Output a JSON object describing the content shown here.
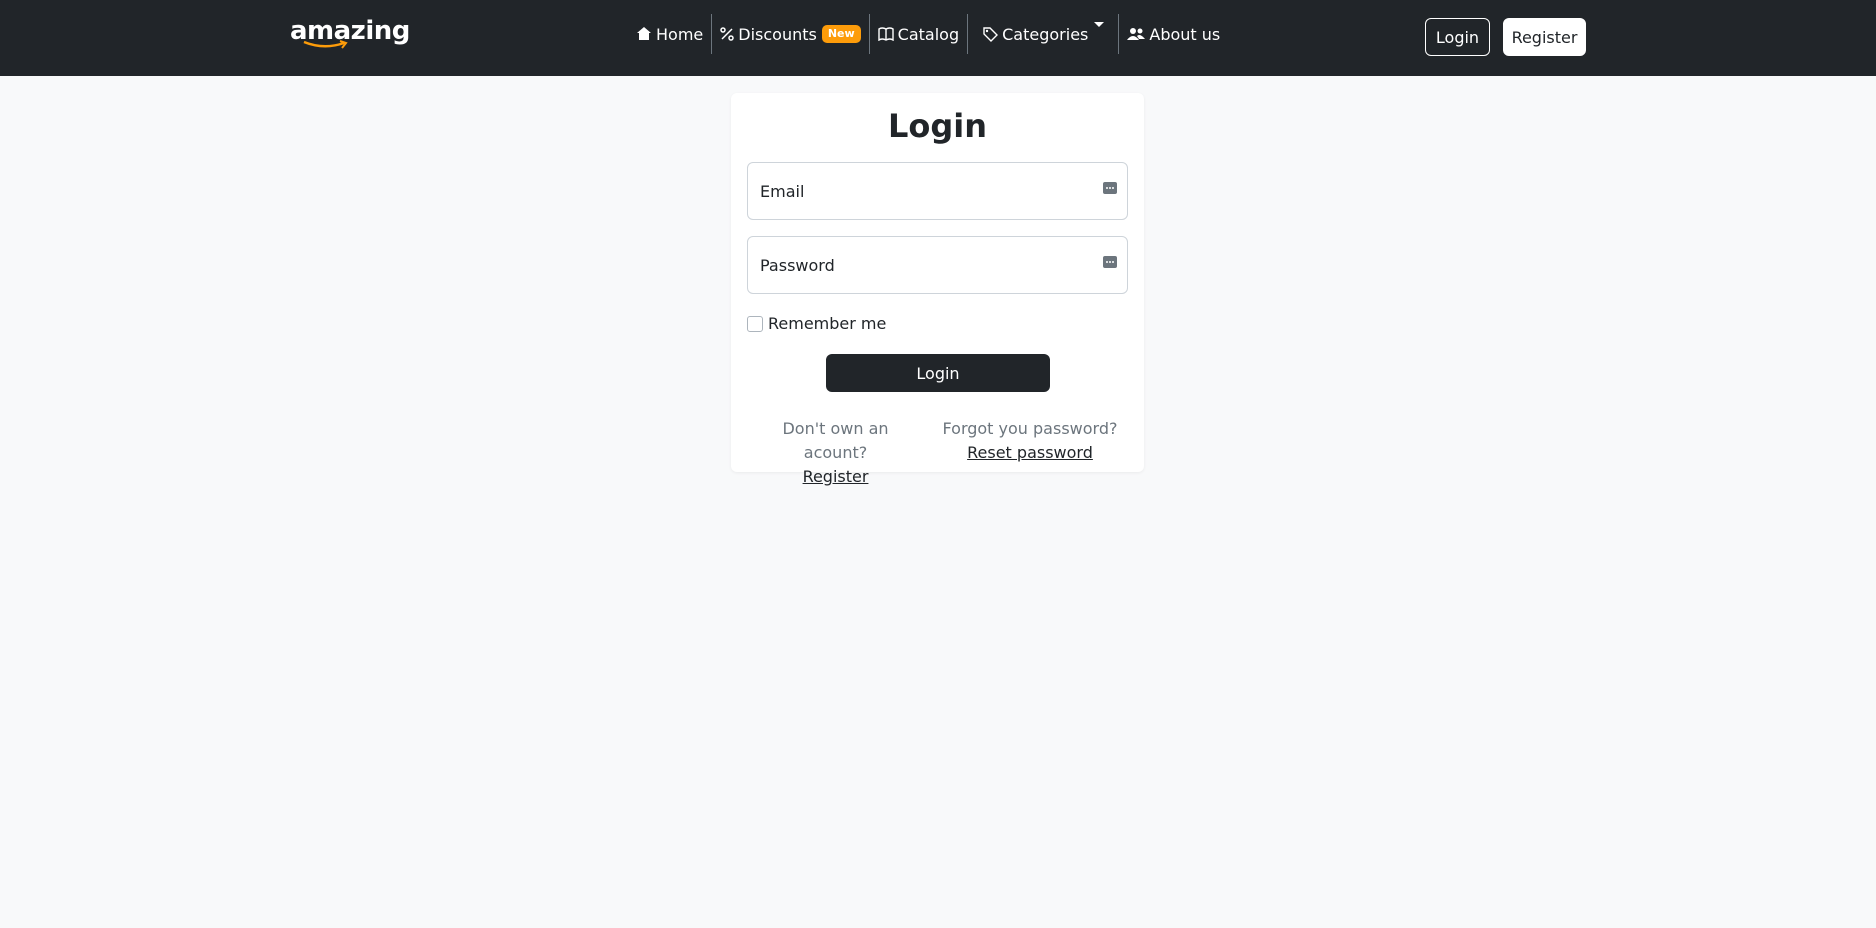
{
  "brand": {
    "name": "amazing"
  },
  "nav": {
    "items": [
      {
        "label": "Home",
        "icon": "home-icon"
      },
      {
        "label": "Discounts",
        "icon": "percent-icon",
        "badge": "New"
      },
      {
        "label": "Catalog",
        "icon": "book-icon"
      },
      {
        "label": "Categories",
        "icon": "tag-icon",
        "dropdown": true
      },
      {
        "label": "About us",
        "icon": "people-icon"
      }
    ]
  },
  "header": {
    "login_label": "Login",
    "register_label": "Register"
  },
  "login_form": {
    "title": "Login",
    "email_placeholder": "Email",
    "password_placeholder": "Password",
    "remember_label": "Remember me",
    "submit_label": "Login",
    "register_prompt": "Don't own an acount?",
    "register_link": "Register",
    "forgot_prompt": "Forgot you password?",
    "reset_link": "Reset password"
  },
  "colors": {
    "navbar": "#212529",
    "page_background": "#f8f9fa",
    "badge": "#fd9c0a",
    "submit_button": "#212529"
  }
}
